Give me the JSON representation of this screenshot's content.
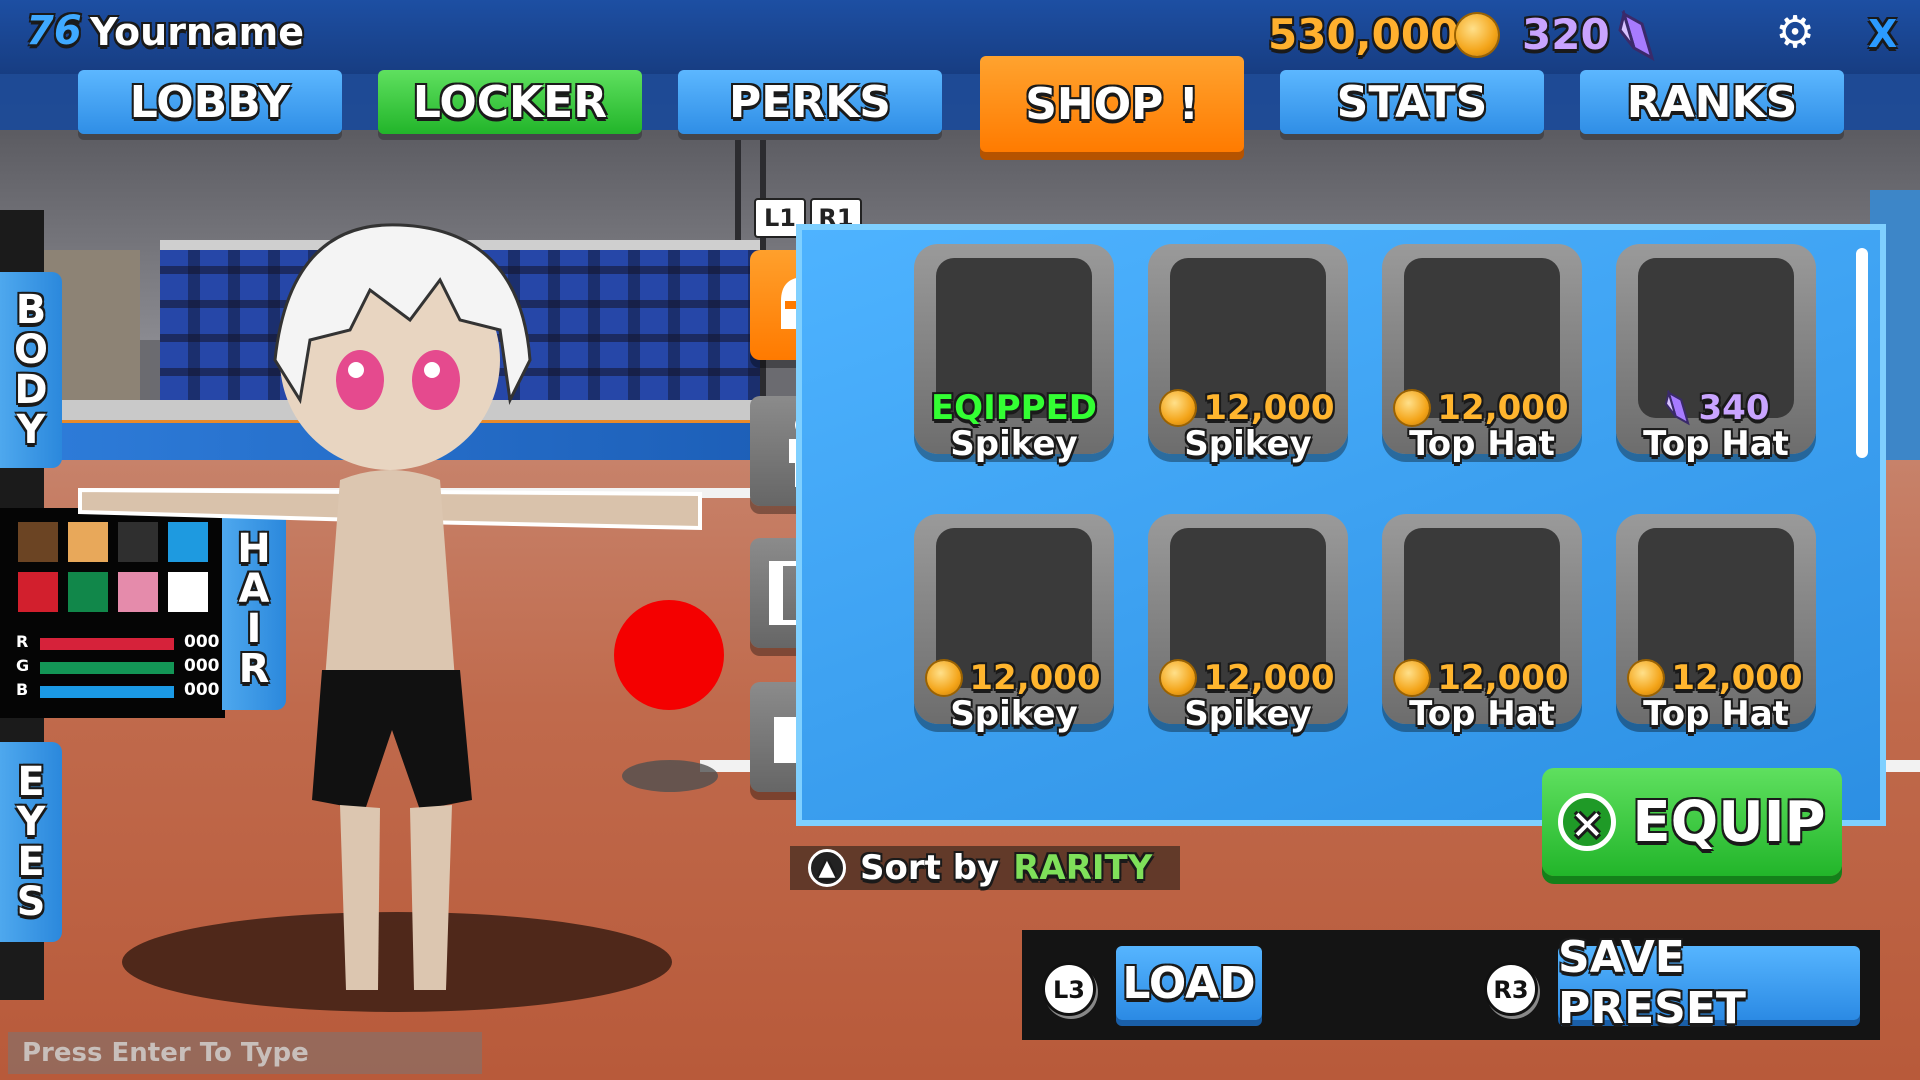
{
  "player": {
    "level": "76",
    "name": "Yourname"
  },
  "currency": {
    "coins": "530,000",
    "gems": "320"
  },
  "nav": {
    "lobby": "LOBBY",
    "locker": "LOCKER",
    "perks": "PERKS",
    "shop": "SHOP !",
    "stats": "STATS",
    "ranks": "RANKS"
  },
  "close_label": "X",
  "side_tabs": {
    "body": [
      "B",
      "O",
      "D",
      "Y"
    ],
    "hair": [
      "H",
      "A",
      "I",
      "R"
    ],
    "eyes": [
      "E",
      "Y",
      "E",
      "S"
    ]
  },
  "palette": {
    "colors": [
      "#6b4423",
      "#e8a85a",
      "#2f2f2f",
      "#1e9ae0",
      "#d21f2d",
      "#11874a",
      "#e58bab",
      "#ffffff"
    ],
    "rgb": [
      {
        "label": "R",
        "value": "000",
        "color": "#d6223a"
      },
      {
        "label": "G",
        "value": "000",
        "color": "#139656"
      },
      {
        "label": "B",
        "value": "000",
        "color": "#1b9ae6"
      }
    ]
  },
  "shoulder_buttons": {
    "left": "L1",
    "right": "R1"
  },
  "items": [
    {
      "status": "EQIPPED",
      "price": "",
      "currency": "",
      "name": "Spikey"
    },
    {
      "status": "",
      "price": "12,000",
      "currency": "coin",
      "name": "Spikey"
    },
    {
      "status": "",
      "price": "12,000",
      "currency": "coin",
      "name": "Top Hat"
    },
    {
      "status": "",
      "price": "340",
      "currency": "gem",
      "name": "Top Hat"
    },
    {
      "status": "",
      "price": "12,000",
      "currency": "coin",
      "name": "Spikey"
    },
    {
      "status": "",
      "price": "12,000",
      "currency": "coin",
      "name": "Spikey"
    },
    {
      "status": "",
      "price": "12,000",
      "currency": "coin",
      "name": "Top Hat"
    },
    {
      "status": "",
      "price": "12,000",
      "currency": "coin",
      "name": "Top Hat"
    }
  ],
  "equip_label": "EQUIP",
  "sort": {
    "prefix": "Sort by",
    "value": "RARITY"
  },
  "bottom": {
    "l3": "L3",
    "load": "LOAD",
    "r3": "R3",
    "save": "SAVE PRESET"
  },
  "chat_placeholder": "Press Enter To Type",
  "colors": {
    "accent_blue": "#2f8ee6",
    "accent_green": "#22b52a",
    "accent_orange": "#ff7b00"
  }
}
